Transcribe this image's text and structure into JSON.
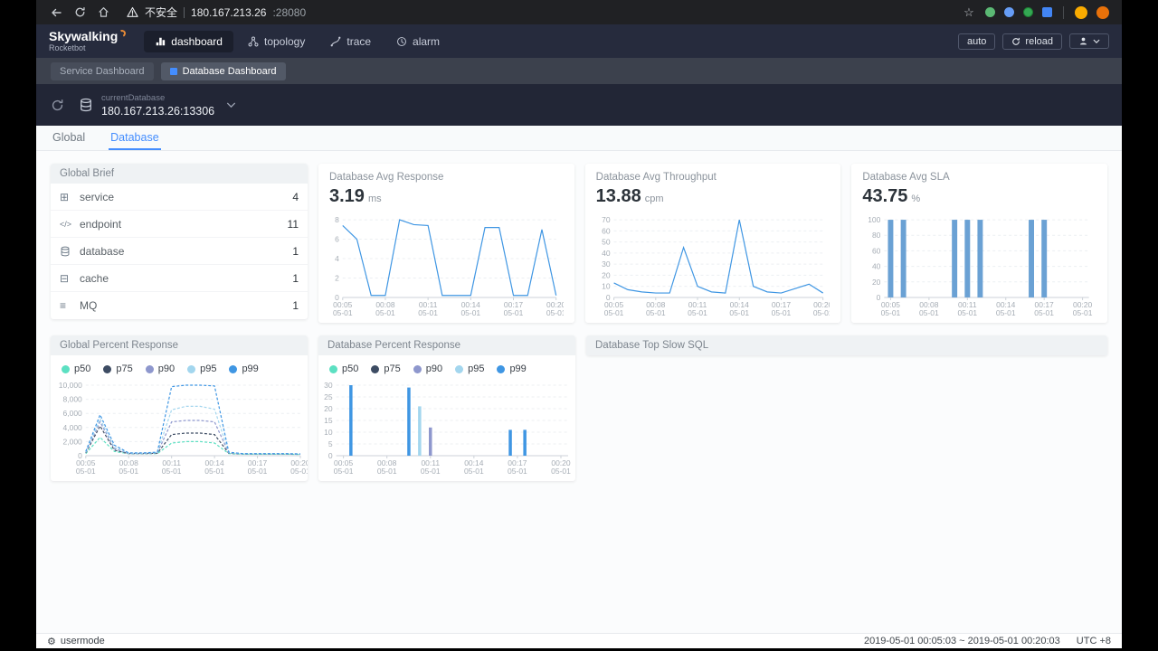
{
  "browser": {
    "security_warning": "不安全",
    "url_host": "180.167.213.26",
    "url_port": ":28080"
  },
  "icons": {
    "star": "☆",
    "gear": "⚙"
  },
  "navbar": {
    "logo_title": "Skywalking",
    "logo_subtitle": "Rocketbot",
    "items": [
      {
        "label": "dashboard",
        "active": true
      },
      {
        "label": "topology",
        "active": false
      },
      {
        "label": "trace",
        "active": false
      },
      {
        "label": "alarm",
        "active": false
      }
    ],
    "auto_label": "auto",
    "reload_label": "reload"
  },
  "dashboard_tabs": [
    {
      "label": "Service Dashboard",
      "active": false
    },
    {
      "label": "Database Dashboard",
      "active": true
    }
  ],
  "toolbar": {
    "selector_label": "currentDatabase",
    "selector_value": "180.167.213.26:13306"
  },
  "view_tabs": [
    {
      "label": "Global",
      "active": false
    },
    {
      "label": "Database",
      "active": true
    }
  ],
  "brief": {
    "title": "Global Brief",
    "items": [
      {
        "icon": "service-icon",
        "glyph": "⊞",
        "label": "service",
        "value": "4"
      },
      {
        "icon": "endpoint-icon",
        "glyph": "</>",
        "label": "endpoint",
        "value": "11"
      },
      {
        "icon": "database-icon",
        "glyph": "",
        "label": "database",
        "value": "1"
      },
      {
        "icon": "cache-icon",
        "glyph": "⊟",
        "label": "cache",
        "value": "1"
      },
      {
        "icon": "mq-icon",
        "glyph": "≡",
        "label": "MQ",
        "value": "1"
      }
    ]
  },
  "metrics": [
    {
      "title": "Database Avg Response",
      "value": "3.19",
      "unit": "ms"
    },
    {
      "title": "Database Avg Throughput",
      "value": "13.88",
      "unit": "cpm"
    },
    {
      "title": "Database Avg SLA",
      "value": "43.75",
      "unit": "%"
    }
  ],
  "panels": {
    "global_percent": {
      "title": "Global Percent Response"
    },
    "db_percent": {
      "title": "Database Percent Response"
    },
    "slow_sql": {
      "title": "Database Top Slow SQL"
    }
  },
  "percent_legend": [
    {
      "label": "p50",
      "color": "#5ce0c2"
    },
    {
      "label": "p75",
      "color": "#3d4c63"
    },
    {
      "label": "p90",
      "color": "#8e97cd"
    },
    {
      "label": "p95",
      "color": "#a3d6ee"
    },
    {
      "label": "p99",
      "color": "#3f96e3"
    }
  ],
  "footer": {
    "usermode": "usermode",
    "time_range": "2019-05-01 00:05:03 ~ 2019-05-01 00:20:03",
    "timezone": "UTC +8"
  },
  "colors": {
    "accent_blue": "#448dfe",
    "chart_line": "#3f96e3",
    "sla_bar": "#6aa1d4",
    "navbar_bg": "#262b3d"
  },
  "chart_data": [
    {
      "id": "avg_response",
      "type": "line",
      "title": "Database Avg Response",
      "unit": "ms",
      "avg_value": 3.19,
      "ylim": [
        0,
        8
      ],
      "yticks": [
        0,
        2,
        4,
        6,
        8
      ],
      "xticks": [
        {
          "i": 0,
          "t": "00:05",
          "d": "05-01"
        },
        {
          "i": 3,
          "t": "00:08",
          "d": "05-01"
        },
        {
          "i": 6,
          "t": "00:11",
          "d": "05-01"
        },
        {
          "i": 9,
          "t": "00:14",
          "d": "05-01"
        },
        {
          "i": 12,
          "t": "00:17",
          "d": "05-01"
        },
        {
          "i": 15,
          "t": "00:20",
          "d": "05-01"
        }
      ],
      "color": "#3f96e3",
      "values": [
        7.4,
        6,
        0.2,
        0.2,
        8,
        7.5,
        7.4,
        0.2,
        0.2,
        0.2,
        7.2,
        7.2,
        0.2,
        0.2,
        7,
        0.2
      ]
    },
    {
      "id": "avg_throughput",
      "type": "line",
      "title": "Database Avg Throughput",
      "unit": "cpm",
      "avg_value": 13.88,
      "ylim": [
        0,
        70
      ],
      "yticks": [
        0,
        10,
        20,
        30,
        40,
        50,
        60,
        70
      ],
      "xticks": [
        {
          "i": 0,
          "t": "00:05",
          "d": "05-01"
        },
        {
          "i": 3,
          "t": "00:08",
          "d": "05-01"
        },
        {
          "i": 6,
          "t": "00:11",
          "d": "05-01"
        },
        {
          "i": 9,
          "t": "00:14",
          "d": "05-01"
        },
        {
          "i": 12,
          "t": "00:17",
          "d": "05-01"
        },
        {
          "i": 15,
          "t": "00:20",
          "d": "05-01"
        }
      ],
      "color": "#3f96e3",
      "values": [
        13,
        7,
        5,
        4,
        4,
        45,
        10,
        5,
        4,
        70,
        10,
        5,
        4,
        8,
        12,
        4
      ]
    },
    {
      "id": "avg_sla",
      "type": "bar",
      "title": "Database Avg SLA",
      "unit": "%",
      "avg_value": 43.75,
      "ylim": [
        0,
        100
      ],
      "yticks": [
        0,
        20,
        40,
        60,
        80,
        100
      ],
      "xticks": [
        {
          "i": 0,
          "t": "00:05",
          "d": "05-01"
        },
        {
          "i": 3,
          "t": "00:08",
          "d": "05-01"
        },
        {
          "i": 6,
          "t": "00:11",
          "d": "05-01"
        },
        {
          "i": 9,
          "t": "00:14",
          "d": "05-01"
        },
        {
          "i": 12,
          "t": "00:17",
          "d": "05-01"
        },
        {
          "i": 15,
          "t": "00:20",
          "d": "05-01"
        }
      ],
      "color": "#6aa1d4",
      "values": [
        100,
        100,
        0,
        0,
        0,
        100,
        100,
        100,
        0,
        0,
        0,
        100,
        100,
        0,
        0,
        0
      ]
    },
    {
      "id": "global_percent",
      "type": "line",
      "title": "Global Percent Response",
      "dashed": true,
      "ylim": [
        0,
        10000
      ],
      "yticks": [
        0,
        2000,
        4000,
        6000,
        8000,
        10000
      ],
      "ytick_labels": [
        "0",
        "2,000",
        "4,000",
        "6,000",
        "8,000",
        "10,000"
      ],
      "xticks": [
        {
          "i": 0,
          "t": "00:05",
          "d": "05-01"
        },
        {
          "i": 3,
          "t": "00:08",
          "d": "05-01"
        },
        {
          "i": 6,
          "t": "00:11",
          "d": "05-01"
        },
        {
          "i": 9,
          "t": "00:14",
          "d": "05-01"
        },
        {
          "i": 12,
          "t": "00:17",
          "d": "05-01"
        },
        {
          "i": 15,
          "t": "00:20",
          "d": "05-01"
        }
      ],
      "series": [
        {
          "name": "p50",
          "color": "#5ce0c2",
          "values": [
            300,
            2600,
            600,
            280,
            280,
            300,
            1800,
            2000,
            2000,
            1800,
            300,
            220,
            220,
            220,
            220,
            180
          ]
        },
        {
          "name": "p75",
          "color": "#3d4c63",
          "values": [
            380,
            4200,
            800,
            300,
            300,
            350,
            3000,
            3200,
            3200,
            3000,
            350,
            240,
            240,
            240,
            240,
            200
          ]
        },
        {
          "name": "p90",
          "color": "#8e97cd",
          "values": [
            450,
            4800,
            1000,
            320,
            320,
            400,
            4800,
            5000,
            5000,
            4800,
            400,
            260,
            260,
            260,
            260,
            210
          ]
        },
        {
          "name": "p95",
          "color": "#a3d6ee",
          "values": [
            500,
            5200,
            1200,
            350,
            350,
            450,
            6500,
            7000,
            7000,
            6600,
            450,
            280,
            280,
            280,
            280,
            230
          ]
        },
        {
          "name": "p99",
          "color": "#3f96e3",
          "values": [
            600,
            5800,
            1500,
            400,
            400,
            500,
            9800,
            10000,
            10000,
            9900,
            500,
            300,
            300,
            300,
            300,
            250
          ]
        }
      ]
    },
    {
      "id": "db_percent",
      "type": "bar",
      "title": "Database Percent Response",
      "ylim": [
        0,
        30
      ],
      "yticks": [
        0,
        5,
        10,
        15,
        20,
        25,
        30
      ],
      "xticks": [
        {
          "i": 0,
          "t": "00:05",
          "d": "05-01"
        },
        {
          "i": 3,
          "t": "00:08",
          "d": "05-01"
        },
        {
          "i": 6,
          "t": "00:11",
          "d": "05-01"
        },
        {
          "i": 9,
          "t": "00:14",
          "d": "05-01"
        },
        {
          "i": 12,
          "t": "00:17",
          "d": "05-01"
        },
        {
          "i": 15,
          "t": "00:20",
          "d": "05-01"
        }
      ],
      "series": [
        {
          "name": "p50",
          "color": "#5ce0c2",
          "values": [
            0,
            0,
            0,
            0,
            0,
            0,
            0,
            0,
            0,
            0,
            0,
            0,
            0,
            0,
            0,
            0
          ]
        },
        {
          "name": "p75",
          "color": "#3d4c63",
          "values": [
            0,
            0,
            0,
            0,
            0,
            0,
            0,
            0,
            0,
            0,
            0,
            0,
            0,
            0,
            0,
            0
          ]
        },
        {
          "name": "p90",
          "color": "#8e97cd",
          "values": [
            0,
            0,
            0,
            0,
            0,
            0,
            12,
            0,
            0,
            0,
            0,
            0,
            0,
            0,
            0,
            0
          ]
        },
        {
          "name": "p95",
          "color": "#a3d6ee",
          "values": [
            0,
            0,
            0,
            0,
            0,
            21,
            0,
            0,
            0,
            0,
            0,
            0,
            0,
            0,
            0,
            0
          ]
        },
        {
          "name": "p99",
          "color": "#3f96e3",
          "values": [
            30,
            0,
            0,
            0,
            29,
            0,
            0,
            0,
            0,
            0,
            0,
            11,
            11,
            0,
            0,
            0
          ]
        }
      ]
    }
  ]
}
